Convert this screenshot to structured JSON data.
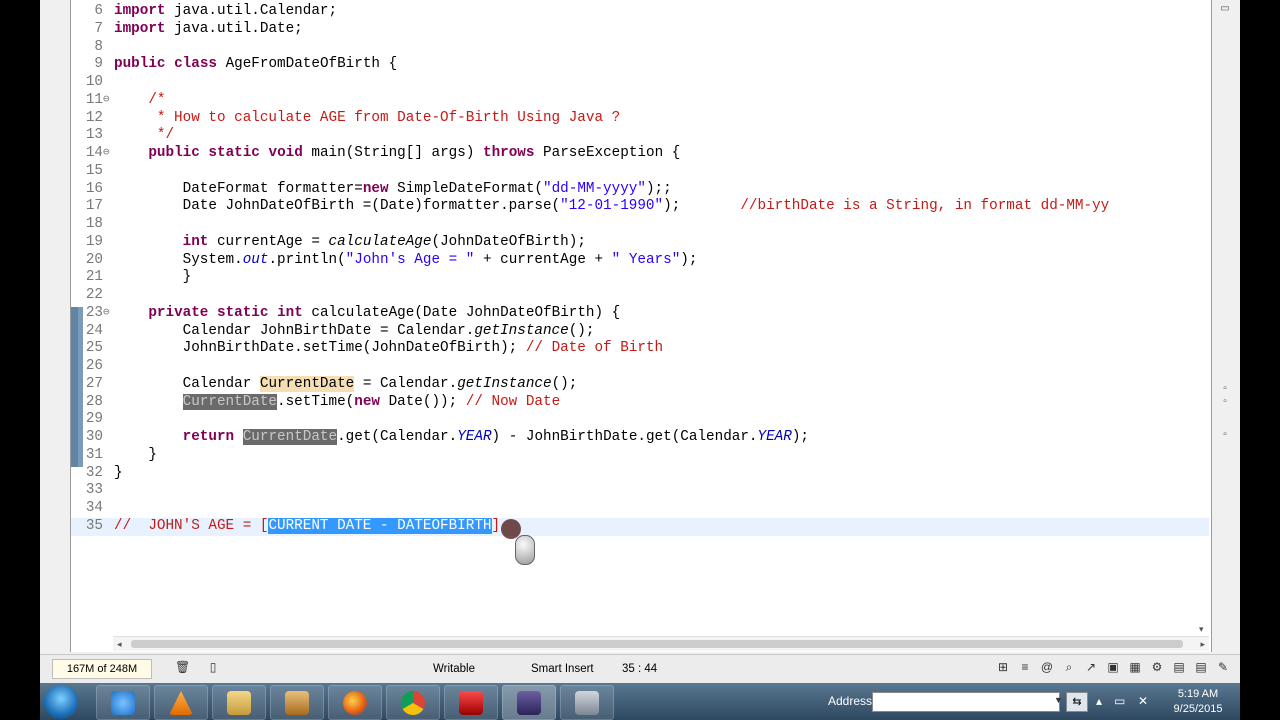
{
  "editor": {
    "lines": [
      {
        "n": "6",
        "tokens": [
          {
            "t": "import java.util.Calendar;",
            "c": ""
          }
        ]
      },
      {
        "n": "7",
        "tokens": [
          {
            "t": "import java.util.Date;",
            "c": ""
          }
        ]
      },
      {
        "n": "8",
        "tokens": []
      },
      {
        "n": "9",
        "tokens": [
          {
            "t": "public class AgeFromDateOfBirth {",
            "c": ""
          }
        ]
      },
      {
        "n": "10",
        "tokens": []
      },
      {
        "n": "11",
        "fold": "⊖",
        "tokens": [
          {
            "t": "    /*",
            "c": "cm"
          }
        ]
      },
      {
        "n": "12",
        "tokens": [
          {
            "t": "     * How to calculate AGE from Date-Of-Birth Using Java ?",
            "c": "cm"
          }
        ]
      },
      {
        "n": "13",
        "tokens": [
          {
            "t": "     */",
            "c": "cm"
          }
        ]
      },
      {
        "n": "14",
        "fold": "⊖",
        "tokens": [
          {
            "t": "    public static void main(String[] args) throws ParseException {",
            "c": ""
          }
        ]
      },
      {
        "n": "15",
        "tokens": []
      },
      {
        "n": "16",
        "tokens": [
          {
            "t": "        DateFormat formatter=new SimpleDateFormat(",
            "c": ""
          },
          {
            "t": "\"dd-MM-yyyy\"",
            "c": "st"
          },
          {
            "t": ");;",
            "c": ""
          }
        ]
      },
      {
        "n": "17",
        "tokens": [
          {
            "t": "        Date JohnDateOfBirth =(Date)formatter.parse(",
            "c": ""
          },
          {
            "t": "\"12-01-1990\"",
            "c": "st"
          },
          {
            "t": ");       ",
            "c": ""
          },
          {
            "t": "//birthDate is a String, in format dd-MM-yy",
            "c": "cm"
          }
        ]
      },
      {
        "n": "18",
        "tokens": []
      },
      {
        "n": "19",
        "tokens": [
          {
            "t": "        int currentAge = ",
            "c": ""
          },
          {
            "t": "calculateAge",
            "c": "it"
          },
          {
            "t": "(JohnDateOfBirth);",
            "c": ""
          }
        ]
      },
      {
        "n": "20",
        "tokens": [
          {
            "t": "        System.",
            "c": ""
          },
          {
            "t": "out",
            "c": "fld"
          },
          {
            "t": ".println(",
            "c": ""
          },
          {
            "t": "\"John's Age = \"",
            "c": "st"
          },
          {
            "t": " + currentAge + ",
            "c": ""
          },
          {
            "t": "\" Years\"",
            "c": "st"
          },
          {
            "t": ");",
            "c": ""
          }
        ]
      },
      {
        "n": "21",
        "tokens": [
          {
            "t": "        }",
            "c": ""
          }
        ]
      },
      {
        "n": "22",
        "tokens": []
      },
      {
        "n": "23",
        "fold": "⊖",
        "tokens": [
          {
            "t": "    private static int calculateAge(Date JohnDateOfBirth) {",
            "c": ""
          }
        ]
      },
      {
        "n": "24",
        "tokens": [
          {
            "t": "        Calendar JohnBirthDate = Calendar.",
            "c": ""
          },
          {
            "t": "getInstance",
            "c": "it"
          },
          {
            "t": "();",
            "c": ""
          }
        ]
      },
      {
        "n": "25",
        "tokens": [
          {
            "t": "        JohnBirthDate.setTime(JohnDateOfBirth); ",
            "c": ""
          },
          {
            "t": "// Date of Birth",
            "c": "cm"
          }
        ]
      },
      {
        "n": "26",
        "tokens": []
      },
      {
        "n": "27",
        "tokens": [
          {
            "t": "        Calendar ",
            "c": ""
          },
          {
            "t": "CurrentDate",
            "c": "occ"
          },
          {
            "t": " = Calendar.",
            "c": ""
          },
          {
            "t": "getInstance",
            "c": "it"
          },
          {
            "t": "();",
            "c": ""
          }
        ]
      },
      {
        "n": "28",
        "tokens": [
          {
            "t": "        ",
            "c": ""
          },
          {
            "t": "CurrentDate",
            "c": "occw"
          },
          {
            "t": ".setTime(new Date()); ",
            "c": ""
          },
          {
            "t": "// Now Date",
            "c": "cm"
          }
        ]
      },
      {
        "n": "29",
        "tokens": []
      },
      {
        "n": "30",
        "tokens": [
          {
            "t": "        return ",
            "c": ""
          },
          {
            "t": "CurrentDate",
            "c": "occw"
          },
          {
            "t": ".get(Calendar.",
            "c": ""
          },
          {
            "t": "YEAR",
            "c": "fld"
          },
          {
            "t": ") - JohnBirthDate.get(Calendar.",
            "c": ""
          },
          {
            "t": "YEAR",
            "c": "fld"
          },
          {
            "t": ");",
            "c": ""
          }
        ]
      },
      {
        "n": "31",
        "tokens": [
          {
            "t": "    }",
            "c": ""
          }
        ]
      },
      {
        "n": "32",
        "tokens": [
          {
            "t": "}",
            "c": ""
          }
        ]
      },
      {
        "n": "33",
        "tokens": []
      },
      {
        "n": "34",
        "tokens": []
      },
      {
        "n": "35",
        "cur": true,
        "tokens": [
          {
            "t": "//  JOHN'S AGE = [",
            "c": "cm"
          },
          {
            "t": "CURRENT DATE - DATEOFBIRTH",
            "c": "sel"
          },
          {
            "t": "]",
            "c": "cm"
          }
        ]
      }
    ]
  },
  "status": {
    "heap": "167M of 248M",
    "mode": "Writable",
    "insert": "Smart Insert",
    "position": "35 : 44"
  },
  "taskbar": {
    "address_label": "Address",
    "time": "5:19 AM",
    "date": "9/25/2015",
    "apps": [
      "internet-explorer",
      "vlc",
      "file-explorer",
      "media-player",
      "firefox",
      "chrome",
      "flash",
      "eclipse",
      "storage"
    ]
  },
  "colors": {
    "keyword": "#7f0055",
    "comment": "#c41a16",
    "string": "#2a00ff",
    "selection": "#3399ff",
    "current_line": "#e8f2fe"
  }
}
